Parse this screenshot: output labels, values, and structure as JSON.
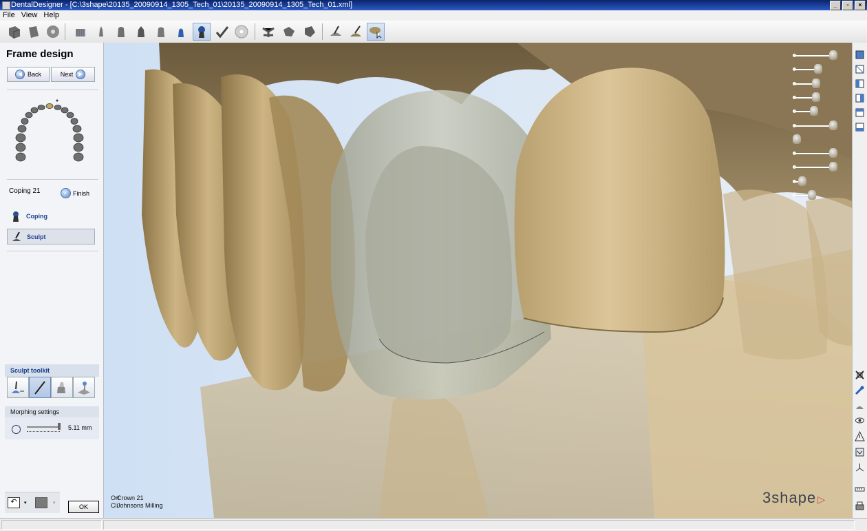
{
  "window": {
    "title": "DentalDesigner - [C:\\3shape\\20135_20090914_1305_Tech_01\\20135_20090914_1305_Tech_01.xml]"
  },
  "menu": [
    "File",
    "View",
    "Help"
  ],
  "toolbar": {
    "icons": [
      "import-icon",
      "order-icon",
      "disc-icon",
      "model-icon",
      "die-icon",
      "tooth-icon",
      "preparation-icon",
      "tooth-outline-icon",
      "abutment-icon",
      "coping-icon",
      "check-icon",
      "cd-icon",
      "connector-icon",
      "connector2-icon",
      "connector3-icon",
      "cut-icon",
      "sculpt-icon",
      "morph-icon"
    ]
  },
  "panel": {
    "title": "Frame design",
    "back_label": "Back",
    "next_label": "Next",
    "job_label": "Coping 21",
    "finish_label": "Finish",
    "steps": [
      {
        "label": "Coping"
      },
      {
        "label": "Sculpt"
      }
    ],
    "toolkit_title": "Sculpt toolkit",
    "toolkit_tools": [
      "add-wax-icon",
      "knife-icon",
      "smooth-icon",
      "morph-tool-icon"
    ],
    "morph_title": "Morphing settings",
    "morph_value": "5.11 mm",
    "ok_label": "OK"
  },
  "viewport": {
    "info_line1": "Crown 21",
    "info_line2": "Johnsons Milling",
    "info_overlap1": "Ort",
    "info_overlap2": "Cli",
    "brand": "3shape"
  },
  "opacity_sliders": {
    "levels": [
      0.95,
      0.55,
      0.5,
      0.5,
      0.45,
      0.95,
      0.0,
      0.95,
      0.95,
      0.15,
      0.4
    ]
  },
  "right_toolbar": {
    "icons": [
      "view-front-icon",
      "view-back-icon",
      "view-left-icon",
      "view-right-icon",
      "view-top-icon",
      "view-bottom-icon",
      "fit-icon",
      "tools-icon",
      "wax-icon",
      "eye-icon",
      "warning-icon",
      "section-icon",
      "axis-icon",
      "ruler-icon",
      "print-icon"
    ]
  },
  "colors": {
    "tooth": "#cbb280",
    "coping": "#b7bcae",
    "bg": "#dce7f4"
  }
}
